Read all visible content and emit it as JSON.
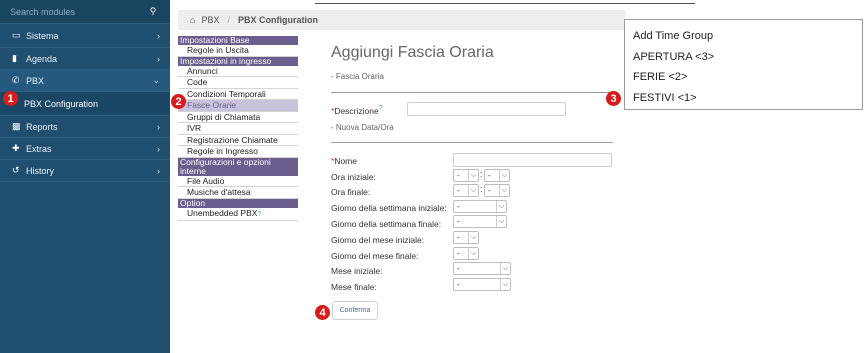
{
  "sidebar": {
    "search_placeholder": "Search modules",
    "search_icon": "search-icon",
    "items": [
      {
        "label": "Sistema",
        "icon": "laptop-icon",
        "arrow": "›"
      },
      {
        "label": "Agenda",
        "icon": "book-icon",
        "arrow": "›"
      },
      {
        "label": "PBX",
        "icon": "phone-icon",
        "arrow": "⌄"
      },
      {
        "label": "PBX Configuration"
      },
      {
        "label": "Reports",
        "icon": "chart-icon",
        "arrow": "›"
      },
      {
        "label": "Extras",
        "icon": "plus-icon",
        "arrow": "›"
      },
      {
        "label": "History",
        "icon": "history-icon",
        "arrow": "›"
      }
    ]
  },
  "breadcrumb": {
    "home_icon": "home-icon",
    "root": "PBX",
    "sep": "/",
    "current": "PBX Configuration"
  },
  "menu": {
    "sections": [
      {
        "header": "Impostazioni Base",
        "items": [
          "Regole in Uscita"
        ]
      },
      {
        "header": "Impostazioni in ingresso",
        "items": [
          "Annunci",
          "Code",
          "Condizioni Temporali",
          "Fasce Orarie",
          "Gruppi di Chiamata",
          "IVR",
          "Registrazione Chiamate",
          "Regole in Ingresso"
        ]
      },
      {
        "header": "Configurazioni e opzioni interne",
        "items": [
          "File Audio",
          "Musiche d'attesa"
        ]
      },
      {
        "header": "Option",
        "items": [
          "Unembedded PBX"
        ]
      }
    ],
    "selected": "Fasce Orarie"
  },
  "form": {
    "title": "Aggiungi Fascia Oraria",
    "section1": "- Fascia Oraria",
    "descrizione_label": "Descrizione",
    "descrizione_value": "",
    "section2": "- Nuova Data/Ora",
    "nome_label": "Nome",
    "nome_value": "",
    "required_mark": "*",
    "help_mark": "?",
    "fields": [
      {
        "label": "Ora iniziale:",
        "a": "-",
        "b": "-"
      },
      {
        "label": "Ora finale:",
        "a": "-",
        "b": "-"
      },
      {
        "label": "Giorno della settimana iniziale:",
        "a": "-"
      },
      {
        "label": "Giorno della settimana finale:",
        "a": "-"
      },
      {
        "label": "Giorno del mese iniziale:",
        "a": "-"
      },
      {
        "label": "Giorno del mese finale:",
        "a": "-"
      },
      {
        "label": "Mese iniziale:",
        "a": "-"
      },
      {
        "label": "Mese finale:",
        "a": "-"
      }
    ],
    "colon": ":",
    "confirm_label": "Conferma"
  },
  "popup": {
    "items": [
      "Add Time Group",
      "APERTURA <3>",
      "FERIE <2>",
      "FESTIVI <1>"
    ]
  },
  "markers": [
    "1",
    "2",
    "3",
    "4"
  ],
  "colors": {
    "sidebar": "#1f4e6e",
    "menu_header": "#6b5e8e",
    "marker": "#d81b1b"
  }
}
